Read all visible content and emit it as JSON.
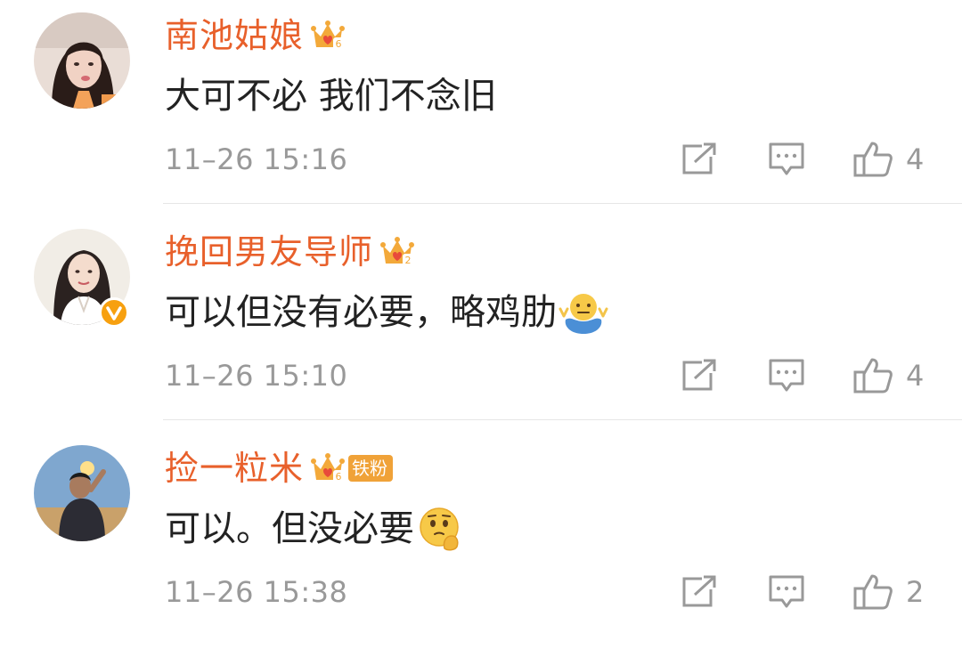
{
  "comments": [
    {
      "username": "南池姑娘",
      "crown_level": "6",
      "fan_badge": "",
      "verified": false,
      "text": "大可不必 我们不念旧",
      "emoji": "",
      "time": "11–26 15:16",
      "likes": "4"
    },
    {
      "username": "挽回男友导师",
      "crown_level": "2",
      "fan_badge": "",
      "verified": true,
      "text": "可以但没有必要，略鸡肋",
      "emoji": "shrug-emoji",
      "time": "11–26 15:10",
      "likes": "4"
    },
    {
      "username": "捡一粒米",
      "crown_level": "6",
      "fan_badge": "铁粉",
      "verified": false,
      "text": "可以。但没必要",
      "emoji": "thinking-emoji",
      "time": "11–26 15:38",
      "likes": "2"
    }
  ],
  "icons": {
    "share": "share-icon",
    "reply": "comment-icon",
    "like": "thumbs-up-icon",
    "crown": "crown-badge-icon",
    "verified": "verified-v-icon"
  },
  "colors": {
    "username": "#e8602b",
    "text": "#222222",
    "meta": "#999999",
    "crown": "#f3a93a",
    "verified": "#f7a00f",
    "divider": "#e6e6e6"
  }
}
